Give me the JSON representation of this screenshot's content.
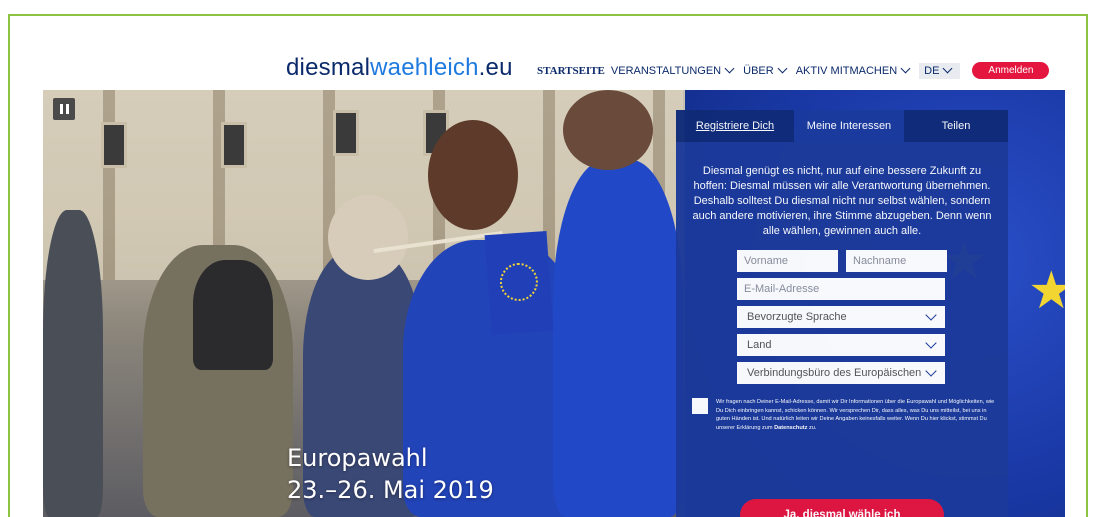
{
  "header": {
    "logo": {
      "part1": "diesmal",
      "part2": "waehleich",
      "part3": ".eu"
    },
    "nav": [
      {
        "label": "STARTSEITE",
        "active": true,
        "dropdown": false
      },
      {
        "label": "VERANSTALTUNGEN",
        "active": false,
        "dropdown": true
      },
      {
        "label": "ÜBER",
        "active": false,
        "dropdown": true
      },
      {
        "label": "AKTIV MITMACHEN",
        "active": false,
        "dropdown": true
      }
    ],
    "language": "DE",
    "login_label": "Anmelden"
  },
  "hero": {
    "title_line1": "Europawahl",
    "title_line2": "23.–26. Mai 2019",
    "pause_icon": "pause-icon"
  },
  "form": {
    "steps": [
      "Registriere Dich",
      "Meine Interessen",
      "Teilen"
    ],
    "intro": "Diesmal genügt es nicht, nur auf eine bessere Zukunft zu hoffen: Diesmal müssen wir alle Verantwortung übernehmen. Deshalb solltest Du diesmal nicht nur selbst wählen, sondern auch andere motivieren, ihre Stimme abzugeben. Denn wenn alle wählen, gewinnen auch alle.",
    "firstname_placeholder": "Vorname",
    "lastname_placeholder": "Nachname",
    "email_placeholder": "E-Mail-Adresse",
    "language_select": "Bevorzugte Sprache",
    "country_select": "Land",
    "office_select": "Verbindungsbüro des Europäischen",
    "consent_text": "Wir fragen nach Deiner E-Mail-Adresse, damit wir Dir Informationen über die Europawahl und Möglichkeiten, wie Du Dich einbringen kannst, schicken können. Wir versprechen Dir, dass alles, was Du uns mitteilst, bei uns in guten Händen ist. Und natürlich leiten wir Deine Angaben keinesfalls weiter. Wenn Du hier klickst, stimmst Du unserer Erklärung zum ",
    "consent_link": "Datenschutz",
    "consent_end": " zu.",
    "submit_label": "Ja, diesmal wähle ich"
  },
  "colors": {
    "brand_blue": "#0b2a6b",
    "accent_blue": "#1f7ae0",
    "panel_blue": "#1b3a9a",
    "cta_red": "#e4163f",
    "frame_green": "#8cc43f"
  }
}
